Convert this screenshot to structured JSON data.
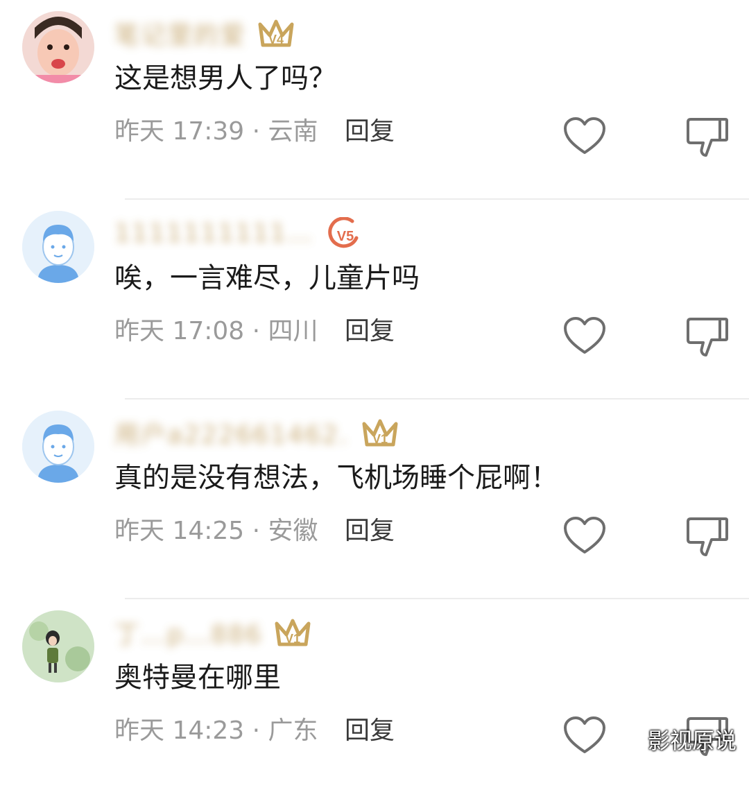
{
  "comments": [
    {
      "username": "笔记里的爱",
      "badge": "V4",
      "text": "这是想男人了吗？",
      "meta": "昨天 17:39 · 云南",
      "reply_label": "回复",
      "badge_color": "#c9a55c",
      "avatar": "avatar-girl-photo"
    },
    {
      "username": "1111111111…",
      "badge": "V5",
      "text": "唉，一言难尽，儿童片吗",
      "meta": "昨天 17:08 · 四川",
      "reply_label": "回复",
      "badge_color": "#e36d4d",
      "avatar": "avatar-default"
    },
    {
      "username": "用户a222661462…",
      "badge": "V1",
      "text": "真的是没有想法，飞机场睡个屁啊！",
      "meta": "昨天 14:25 · 安徽",
      "reply_label": "回复",
      "badge_color": "#c9a55c",
      "avatar": "avatar-default"
    },
    {
      "username": "丁…p…886",
      "badge": "V1",
      "text": "奥特曼在哪里",
      "meta": "昨天 14:23 · 广东",
      "reply_label": "回复",
      "badge_color": "#c9a55c",
      "avatar": "avatar-nature-photo"
    }
  ],
  "watermark": "影视原说",
  "icons": {
    "like": "heart-outline-icon",
    "dislike": "thumbs-down-outline-icon"
  }
}
